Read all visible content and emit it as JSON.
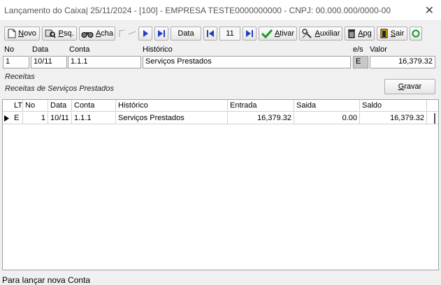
{
  "window": {
    "title": "Lançamento do Caixa|  25/11/2024 - [100] - EMPRESA TESTE0000000000 - CNPJ: 00.000.000/0000-00",
    "close_glyph": "✕"
  },
  "toolbar": {
    "novo_prefix": "N",
    "novo_rest": "ovo",
    "psq_prefix": "P",
    "psq_rest": "sq.",
    "acha_prefix": "A",
    "acha_rest": "cha",
    "data_label": "Data",
    "record_no": "11",
    "ativar_prefix": "A",
    "ativar_rest": "tivar",
    "auxiliar_prefix": "A",
    "auxiliar_rest": "uxiliar",
    "apg_prefix": "A",
    "apg_rest": "pg",
    "sair_prefix": "S",
    "sair_rest": "air"
  },
  "form": {
    "labels": {
      "no": "No",
      "data": "Data",
      "conta": "Conta",
      "historico": "Histórico",
      "es": "e/s",
      "valor": "Valor"
    },
    "values": {
      "no": "1",
      "data": "10/11",
      "conta": "1.1.1",
      "historico": "Serviços Prestados",
      "es": "E",
      "valor": "16,379.32"
    }
  },
  "info": {
    "line1": "Receitas",
    "line2": "Receitas de Serviços Prestados"
  },
  "gravar": {
    "prefix": "G",
    "rest": "ravar"
  },
  "grid": {
    "columns": [
      "LT",
      "No",
      "Data",
      "Conta",
      "Histórico",
      "Entrada",
      "Saida",
      "Saldo"
    ],
    "rows": [
      {
        "lt": "E",
        "no": "1",
        "data": "10/11",
        "conta": "1.1.1",
        "historico": "Serviços Prestados",
        "entrada": "16,379.32",
        "saida": "0.00",
        "saldo": "16,379.32"
      }
    ]
  },
  "status": {
    "text": "Para lançar nova Conta"
  },
  "colors": {
    "accent_blue": "#1f3fbf",
    "ok_green": "#1e9a2a"
  }
}
